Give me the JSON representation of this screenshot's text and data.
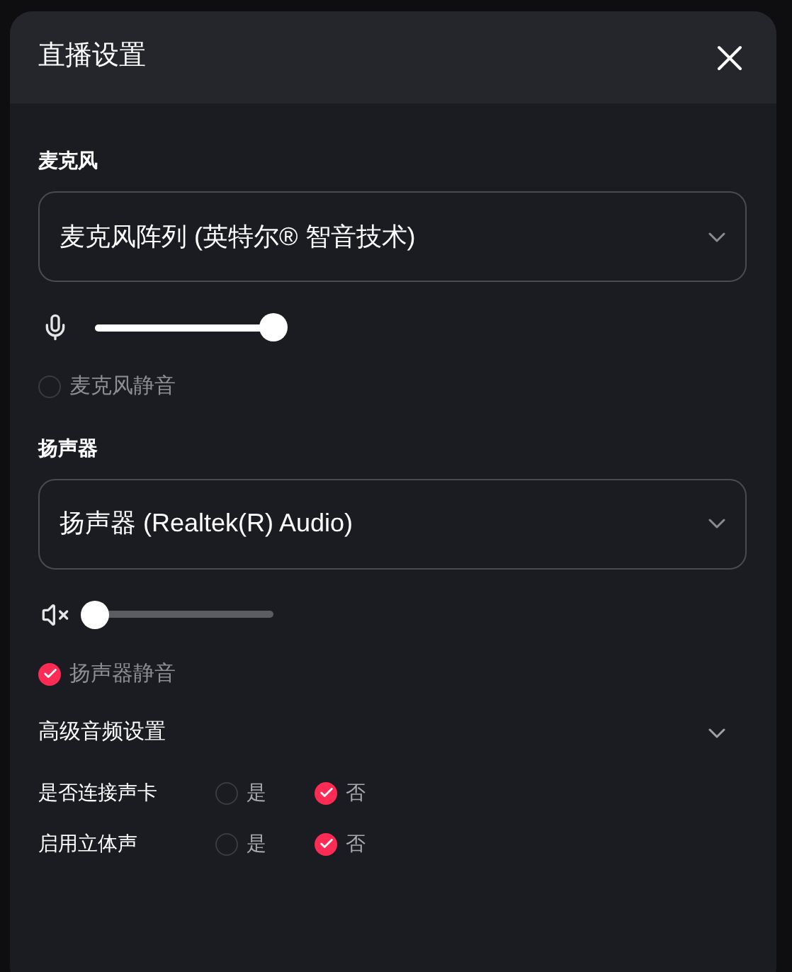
{
  "dialog": {
    "title": "直播设置"
  },
  "devices": [
    {
      "kind": "microphone",
      "label": "麦克风",
      "device": "麦克风阵列 (英特尔® 智音技术)",
      "level": 1,
      "mute": {
        "label": "麦克风静音",
        "checked": false
      }
    },
    {
      "kind": "speaker",
      "label": "扬声器",
      "device": "扬声器 (Realtek(R) Audio)",
      "level": 0,
      "mute": {
        "label": "扬声器静音",
        "checked": true
      }
    }
  ],
  "advanced": {
    "label": "高级音频设置",
    "options": [
      {
        "label": "是否连接声卡",
        "choices": [
          {
            "label": "是",
            "selected": false
          },
          {
            "label": "否",
            "selected": true
          }
        ]
      },
      {
        "label": "启用立体声",
        "choices": [
          {
            "label": "是",
            "selected": false
          },
          {
            "label": "否",
            "selected": true
          }
        ]
      }
    ]
  }
}
